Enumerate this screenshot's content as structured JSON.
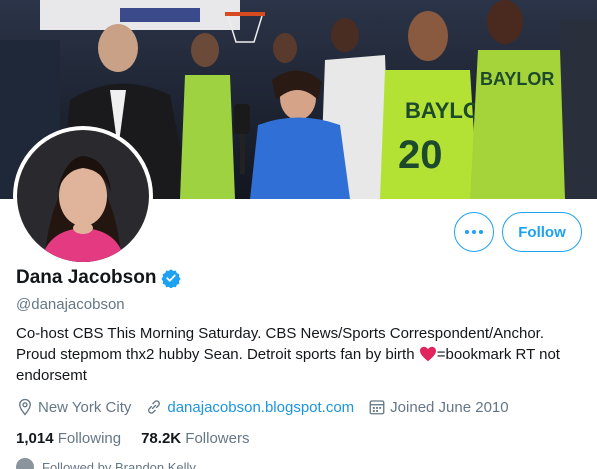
{
  "profile": {
    "name": "Dana Jacobson",
    "handle": "@danajacobson",
    "bio_part1": "Co-host CBS This Morning Saturday. CBS News/Sports Correspondent/Anchor. Proud stepmom thx2 hubby Sean. Detroit sports fan by birth ",
    "bio_part2": "=bookmark RT not endorsemt",
    "location": "New York City",
    "website": "danajacobson.blogspot.com",
    "joined": "Joined June 2010",
    "following_count": "1,014",
    "following_label": "Following",
    "followers_count": "78.2K",
    "followers_label": "Followers",
    "followed_by": "Followed by Brandon Kelly"
  },
  "actions": {
    "follow_label": "Follow"
  },
  "colors": {
    "accent": "#1da1f2",
    "link": "#1b95e0",
    "muted": "#657786",
    "heart": "#e0245e"
  }
}
